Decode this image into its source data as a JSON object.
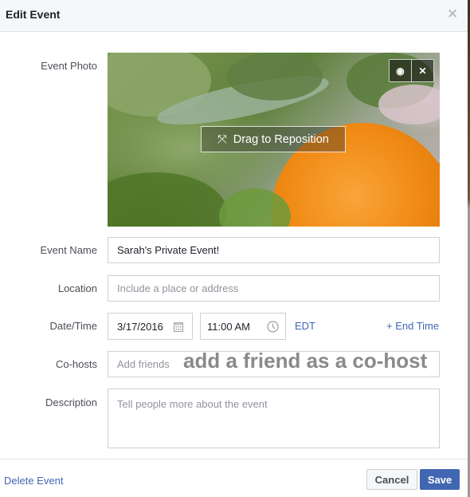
{
  "dialog": {
    "title": "Edit Event",
    "close_icon": "close-icon"
  },
  "photo": {
    "label": "Event Photo",
    "change_icon": "camera-icon",
    "remove_icon": "close-icon",
    "drag_icon": "expand-arrows-icon",
    "drag_label": "Drag to Reposition",
    "camera_glyph": "◉",
    "remove_glyph": "✕",
    "drag_glyph": "⤧"
  },
  "form": {
    "event_name": {
      "label": "Event Name",
      "value": "Sarah's Private Event!"
    },
    "location": {
      "label": "Location",
      "value": "",
      "placeholder": "Include a place or address"
    },
    "datetime": {
      "label": "Date/Time",
      "date": "3/17/2016",
      "time": "11:00 AM",
      "timezone": "EDT",
      "end_time_link": "+ End Time",
      "calendar_icon": "calendar-icon",
      "clock_icon": "clock-icon"
    },
    "cohosts": {
      "label": "Co-hosts",
      "value": "",
      "placeholder": "Add friends"
    },
    "description": {
      "label": "Description",
      "value": "",
      "placeholder": "Tell people more about the event"
    }
  },
  "annotation": {
    "text": "add a friend as a co-host"
  },
  "footer": {
    "delete_label": "Delete Event",
    "cancel_label": "Cancel",
    "save_label": "Save"
  },
  "colors": {
    "accent": "#4267b2",
    "header_bg": "#f6f7f9",
    "border": "#ccd0d5"
  }
}
